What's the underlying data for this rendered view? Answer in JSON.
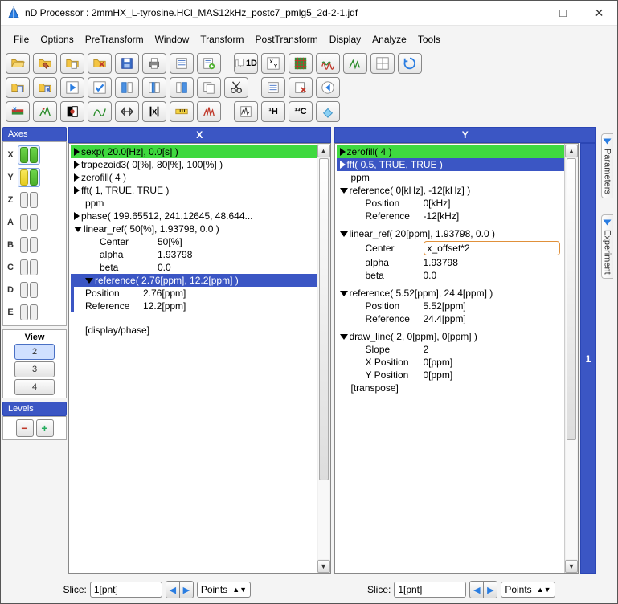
{
  "title": "nD Processor : 2mmHX_L-tyrosine.HCl_MAS12kHz_postc7_pmlg5_2d-2-1.jdf",
  "menus": [
    "File",
    "Options",
    "PreTransform",
    "Window",
    "Transform",
    "PostTransform",
    "Display",
    "Analyze",
    "Tools"
  ],
  "right_tabs": [
    "Parameters",
    "Experiment"
  ],
  "side_index": "1",
  "toolbar_text": {
    "oneD": "1D",
    "oneH": "¹H",
    "thirteenC": "¹³C"
  },
  "axes": {
    "title": "Axes",
    "rows": [
      {
        "label": "X",
        "style": "green",
        "sel": true
      },
      {
        "label": "Y",
        "style": "yellow",
        "sel": true
      },
      {
        "label": "Z",
        "style": "plain",
        "sel": false
      },
      {
        "label": "A",
        "style": "plain",
        "sel": false
      },
      {
        "label": "B",
        "style": "plain",
        "sel": false
      },
      {
        "label": "C",
        "style": "plain",
        "sel": false
      },
      {
        "label": "D",
        "style": "plain",
        "sel": false
      },
      {
        "label": "E",
        "style": "plain",
        "sel": false
      }
    ],
    "view_title": "View",
    "views": [
      "2",
      "3",
      "4"
    ],
    "view_selected": "2"
  },
  "levels_title": "Levels",
  "panels": {
    "x": {
      "header": "X",
      "entries": [
        {
          "kind": "closed",
          "cls": "highlight-green",
          "text": "sexp( 20.0[Hz], 0.0[s] )"
        },
        {
          "kind": "closed",
          "text": "trapezoid3( 0[%], 80[%], 100[%] )"
        },
        {
          "kind": "closed",
          "text": "zerofill( 4 )"
        },
        {
          "kind": "closed",
          "text": "fft( 1, TRUE, TRUE )"
        },
        {
          "kind": "plain",
          "lvl": 1,
          "text": "ppm"
        },
        {
          "kind": "closed",
          "text": "phase( 199.65512, 241.12645, 48.644..."
        },
        {
          "kind": "open",
          "text": "linear_ref( 50[%], 1.93798, 0.0 )"
        },
        {
          "kind": "kv",
          "lvl": 2,
          "k": "Center",
          "v": "50[%]"
        },
        {
          "kind": "kv",
          "lvl": 2,
          "k": "alpha",
          "v": "1.93798"
        },
        {
          "kind": "kv",
          "lvl": 2,
          "k": "beta",
          "v": "0.0"
        },
        {
          "kind": "open",
          "cls": "highlight-blue",
          "bar": true,
          "text": "reference( 2.76[ppm], 12.2[ppm] )"
        },
        {
          "kind": "kv",
          "lvl": 2,
          "bar": true,
          "k": "Position",
          "v": "2.76[ppm]"
        },
        {
          "kind": "kv",
          "lvl": 2,
          "bar": true,
          "k": "Reference",
          "v": "12.2[ppm]"
        },
        {
          "kind": "spacer"
        },
        {
          "kind": "plain",
          "lvl": 1,
          "text": "[display/phase]"
        }
      ]
    },
    "y": {
      "header": "Y",
      "entries": [
        {
          "kind": "closed",
          "cls": "highlight-green",
          "text": "zerofill( 4 )"
        },
        {
          "kind": "closed",
          "cls": "highlight-blue",
          "whiteTri": true,
          "text": "fft( 0.5, TRUE, TRUE )"
        },
        {
          "kind": "plain",
          "lvl": 1,
          "text": "ppm"
        },
        {
          "kind": "open",
          "text": "reference( 0[kHz], -12[kHz] )"
        },
        {
          "kind": "kv",
          "lvl": 2,
          "k": "Position",
          "v": "0[kHz]"
        },
        {
          "kind": "kv",
          "lvl": 2,
          "k": "Reference",
          "v": "-12[kHz]"
        },
        {
          "kind": "spacer-sm"
        },
        {
          "kind": "open",
          "text": "linear_ref( 20[ppm], 1.93798, 0.0 )"
        },
        {
          "kind": "kv-input",
          "lvl": 2,
          "k": "Center",
          "v": "x_offset*2"
        },
        {
          "kind": "kv",
          "lvl": 2,
          "k": "alpha",
          "v": "1.93798"
        },
        {
          "kind": "kv",
          "lvl": 2,
          "k": "beta",
          "v": "0.0"
        },
        {
          "kind": "spacer-sm"
        },
        {
          "kind": "open",
          "text": "reference( 5.52[ppm], 24.4[ppm] )"
        },
        {
          "kind": "kv",
          "lvl": 2,
          "k": "Position",
          "v": "5.52[ppm]"
        },
        {
          "kind": "kv",
          "lvl": 2,
          "k": "Reference",
          "v": "24.4[ppm]"
        },
        {
          "kind": "spacer-sm"
        },
        {
          "kind": "open",
          "text": "draw_line( 2, 0[ppm], 0[ppm] )"
        },
        {
          "kind": "kv",
          "lvl": 2,
          "k": "Slope",
          "v": "2"
        },
        {
          "kind": "kv",
          "lvl": 2,
          "k": "X Position",
          "v": "0[ppm]"
        },
        {
          "kind": "kv",
          "lvl": 2,
          "k": "Y Position",
          "v": "0[ppm]"
        },
        {
          "kind": "plain",
          "lvl": 1,
          "text": "[transpose]"
        }
      ]
    }
  },
  "slice": {
    "label": "Slice:",
    "value": "1[pnt]",
    "units": "Points"
  }
}
